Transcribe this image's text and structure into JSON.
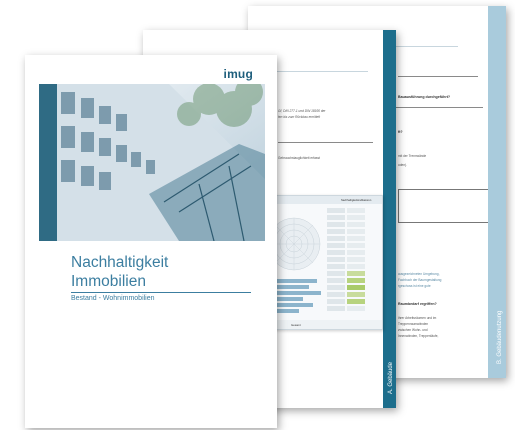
{
  "back_page": {
    "sidebar_label": "B. Gebäudenutzung",
    "snippets": [
      "Bauausführung durchgeführt?",
      "ft?",
      "mit der Trennwände",
      "oden).",
      "ausgezeichneten Umgebung,",
      "Fachbuch der Baumgestaltung",
      "rgeschoss ist eine gute",
      "Raumbedarf ergriffen?",
      "ihrer Arbeitsräumen und im",
      "Treppenraumwänden",
      "zwischen Wohn- und",
      "Innenwänden, Treppenläufe,"
    ]
  },
  "middle_page": {
    "sidebar_label": "A. Gebäude",
    "snippets": [
      "Gf, DIN 277-1 und DIN 18930 der",
      "ten bis zum Rückbau ermittelt",
      "Gebrauchstauglichkeit erfasst"
    ]
  },
  "cover": {
    "logo": "imug",
    "title_line1": "Nachhaltigkeit",
    "title_line2": "Immobilien",
    "subtitle": "Bestand - Wohnimmobilien"
  },
  "dashboard": {
    "header_right": "Nachhaltigkeitsindikatoren",
    "footer": "Gesamt"
  },
  "colors": {
    "accent": "#1d6e8c",
    "light_accent": "#a9cbdc",
    "title": "#3c7ea0"
  }
}
